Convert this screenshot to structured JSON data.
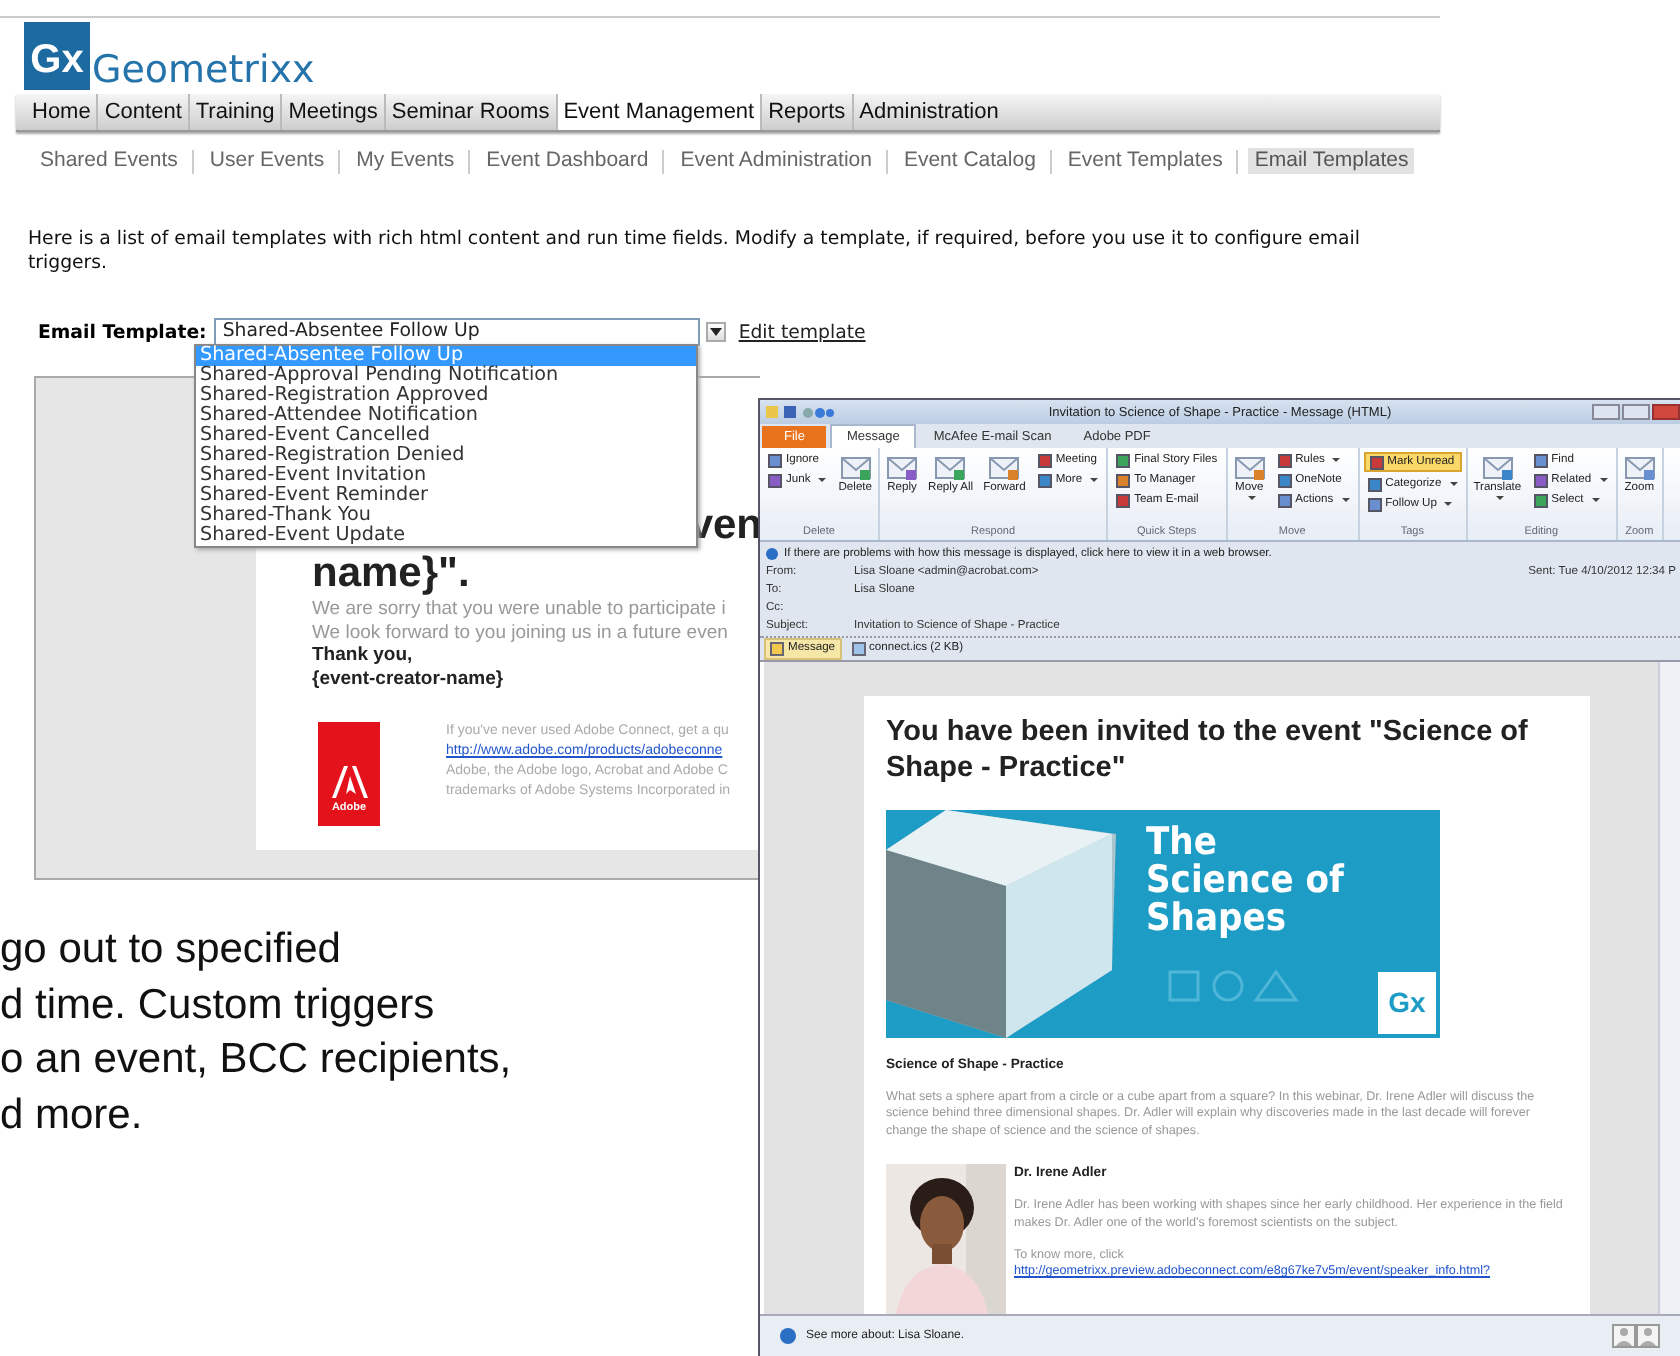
{
  "app": {
    "logo_mark": "Gx",
    "logo_name": "Geometrixx"
  },
  "nav": [
    {
      "label": "Home",
      "selected": false
    },
    {
      "label": "Content",
      "selected": false
    },
    {
      "label": "Training",
      "selected": false
    },
    {
      "label": "Meetings",
      "selected": false
    },
    {
      "label": "Seminar Rooms",
      "selected": false
    },
    {
      "label": "Event Management",
      "selected": true
    },
    {
      "label": "Reports",
      "selected": false
    },
    {
      "label": "Administration",
      "selected": false
    }
  ],
  "subnav": [
    {
      "label": "Shared Events",
      "selected": false
    },
    {
      "label": "User Events",
      "selected": false
    },
    {
      "label": "My Events",
      "selected": false
    },
    {
      "label": "Event Dashboard",
      "selected": false
    },
    {
      "label": "Event Administration",
      "selected": false
    },
    {
      "label": "Event Catalog",
      "selected": false
    },
    {
      "label": "Event Templates",
      "selected": false
    },
    {
      "label": "Email Templates",
      "selected": true
    }
  ],
  "intro": "Here is a list of email templates with rich html content and run time fields. Modify a template, if required, before you use it to configure email triggers.",
  "template_picker": {
    "label": "Email Template:",
    "value": "Shared-Absentee Follow Up",
    "expanded": true,
    "link": "Edit template",
    "options": [
      {
        "label": "Shared-Absentee Follow Up",
        "selected": true
      },
      {
        "label": "Shared-Approval Pending Notification",
        "selected": false
      },
      {
        "label": "Shared-Registration Approved",
        "selected": false
      },
      {
        "label": "Shared-Attendee Notification",
        "selected": false
      },
      {
        "label": "Shared-Event Cancelled",
        "selected": false
      },
      {
        "label": "Shared-Registration Denied",
        "selected": false
      },
      {
        "label": "Shared-Event Invitation",
        "selected": false
      },
      {
        "label": "Shared-Event Reminder",
        "selected": false
      },
      {
        "label": "Shared-Thank You",
        "selected": false
      },
      {
        "label": "Shared-Event Update",
        "selected": false
      }
    ]
  },
  "preview": {
    "heading_lines": [
      "ven",
      "name}\"."
    ],
    "body_lines": [
      "We are sorry that you were unable to participate i",
      "We look forward to you joining us in a future even"
    ],
    "signature_lines": [
      "Thank you,",
      "{event-creator-name}"
    ],
    "logo_text": "Adobe",
    "footer": [
      {
        "kind": "text",
        "text": "If you've never used Adobe Connect, get a qu"
      },
      {
        "kind": "link",
        "text": "http://www.adobe.com/products/adobeconne"
      },
      {
        "kind": "text",
        "text": "Adobe, the Adobe logo, Acrobat and Adobe C"
      },
      {
        "kind": "text",
        "text": "trademarks of Adobe Systems Incorporated in"
      }
    ]
  },
  "caption_lines": [
    "go out to specified",
    "d time. Custom triggers",
    "o an event, BCC recipients,",
    "d more."
  ],
  "outlook": {
    "title": "Invitation to Science of Shape - Practice - Message (HTML)",
    "tabs": [
      {
        "label": "File",
        "kind": "file",
        "selected": false
      },
      {
        "label": "Message",
        "kind": "tab",
        "selected": true
      },
      {
        "label": "McAfee E-mail Scan",
        "kind": "tab",
        "selected": false
      },
      {
        "label": "Adobe PDF",
        "kind": "tab",
        "selected": false
      }
    ],
    "groups": [
      {
        "label": "Delete",
        "items": [
          {
            "label": "Ignore",
            "kind": "small",
            "dropdown": false,
            "on": false
          },
          {
            "label": "Junk",
            "kind": "small",
            "dropdown": true,
            "on": false
          },
          {
            "label": "Delete",
            "kind": "large",
            "dropdown": false,
            "on": false
          }
        ]
      },
      {
        "label": "Respond",
        "items": [
          {
            "label": "Reply",
            "kind": "large",
            "dropdown": false,
            "on": false
          },
          {
            "label": "Reply All",
            "kind": "large",
            "dropdown": false,
            "on": false
          },
          {
            "label": "Forward",
            "kind": "large",
            "dropdown": false,
            "on": false
          },
          {
            "label": "Meeting",
            "kind": "small",
            "dropdown": false,
            "on": false
          },
          {
            "label": "More",
            "kind": "small",
            "dropdown": true,
            "on": false
          }
        ]
      },
      {
        "label": "Quick Steps",
        "items": [
          {
            "label": "Final Story Files",
            "kind": "small",
            "dropdown": false,
            "on": false
          },
          {
            "label": "To Manager",
            "kind": "small",
            "dropdown": false,
            "on": false
          },
          {
            "label": "Team E-mail",
            "kind": "small",
            "dropdown": false,
            "on": false
          }
        ]
      },
      {
        "label": "Move",
        "items": [
          {
            "label": "Move",
            "kind": "large",
            "dropdown": true,
            "on": false
          },
          {
            "label": "Rules",
            "kind": "small",
            "dropdown": true,
            "on": false
          },
          {
            "label": "OneNote",
            "kind": "small",
            "dropdown": false,
            "on": false
          },
          {
            "label": "Actions",
            "kind": "small",
            "dropdown": true,
            "on": false
          }
        ]
      },
      {
        "label": "Tags",
        "items": [
          {
            "label": "Mark Unread",
            "kind": "small",
            "dropdown": false,
            "on": true
          },
          {
            "label": "Categorize",
            "kind": "small",
            "dropdown": true,
            "on": false
          },
          {
            "label": "Follow Up",
            "kind": "small",
            "dropdown": true,
            "on": false
          }
        ]
      },
      {
        "label": "Editing",
        "items": [
          {
            "label": "Translate",
            "kind": "large",
            "dropdown": true,
            "on": false
          },
          {
            "label": "Find",
            "kind": "small",
            "dropdown": false,
            "on": false
          },
          {
            "label": "Related",
            "kind": "small",
            "dropdown": true,
            "on": false
          },
          {
            "label": "Select",
            "kind": "small",
            "dropdown": true,
            "on": false
          }
        ]
      },
      {
        "label": "Zoom",
        "items": [
          {
            "label": "Zoom",
            "kind": "large",
            "dropdown": false,
            "on": false
          }
        ]
      }
    ],
    "infobar": "If there are problems with how this message is displayed, click here to view it in a web browser.",
    "fields": [
      {
        "label": "From:",
        "value": "Lisa Sloane <admin@acrobat.com>"
      },
      {
        "label": "To:",
        "value": "Lisa Sloane"
      },
      {
        "label": "Cc:"
      },
      {
        "label": "Subject:",
        "value": "Invitation to Science of Shape - Practice"
      }
    ],
    "sent": {
      "label": "Sent:",
      "value": "Tue 4/10/2012 12:34 P"
    },
    "attachments": [
      {
        "label": "Message",
        "selected": true
      },
      {
        "label": "connect.ics (2 KB)",
        "selected": false
      }
    ],
    "email": {
      "heading": "You have been invited to the event \"Science of Shape - Practice\"",
      "banner_lines": [
        "The",
        "Science of",
        "Shapes"
      ],
      "banner_logo": "Gx",
      "event_title": "Science of Shape - Practice",
      "description": "What sets a sphere apart from a circle or a cube apart from a square? In this webinar, Dr. Irene Adler will discuss the science behind three dimensional shapes. Dr. Adler will explain why discoveries made in the last decade will forever change the shape of science and the science of shapes.",
      "speaker_name": "Dr. Irene Adler",
      "speaker_bio": "Dr. Irene Adler has been working with shapes since her early childhood. Her experience in the field makes Dr. Adler one of the world's foremost scientists on the subject.",
      "more_text": "To know more, click",
      "more_link": "http://geometrixx.preview.adobeconnect.com/e8g67ke7v5m/event/speaker_info.html?"
    },
    "status": "See more about: Lisa Sloane."
  }
}
